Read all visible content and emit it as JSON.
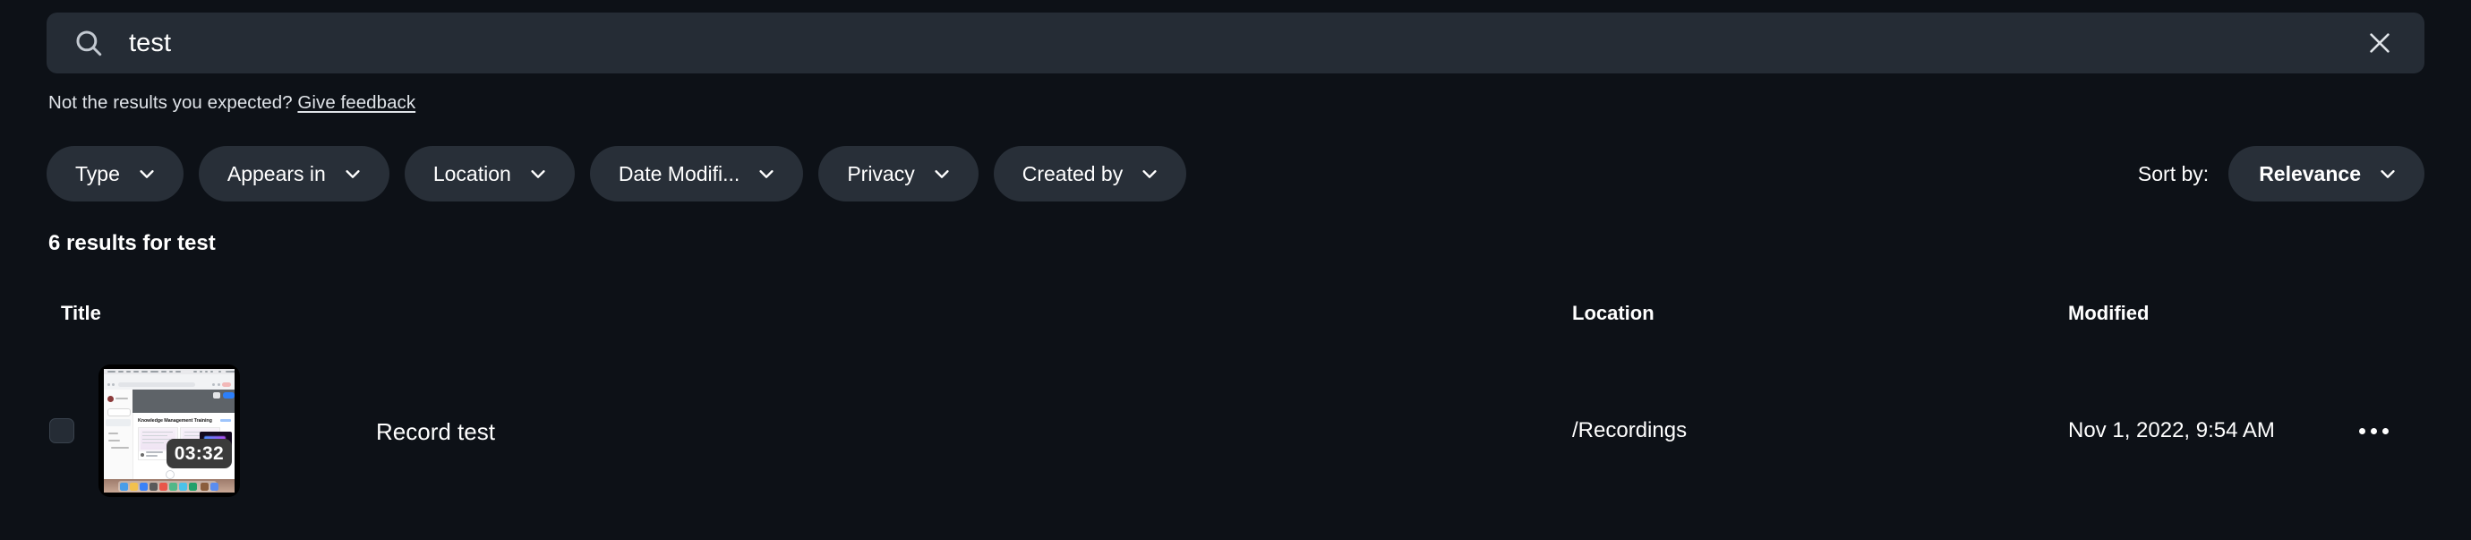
{
  "search": {
    "icon": "search-icon",
    "value": "test",
    "placeholder": "Search",
    "clear_icon": "close-icon"
  },
  "feedback": {
    "text": "Not the results you expected?",
    "link_label": "Give feedback"
  },
  "filters": [
    {
      "label": "Type",
      "icon": "chevron-down-icon"
    },
    {
      "label": "Appears in",
      "icon": "chevron-down-icon"
    },
    {
      "label": "Location",
      "icon": "chevron-down-icon"
    },
    {
      "label": "Date Modifi...",
      "icon": "chevron-down-icon"
    },
    {
      "label": "Privacy",
      "icon": "chevron-down-icon"
    },
    {
      "label": "Created by",
      "icon": "chevron-down-icon"
    }
  ],
  "sort": {
    "label": "Sort by:",
    "value": "Relevance",
    "icon": "chevron-down-icon"
  },
  "results": {
    "count_text": "6 results for test",
    "columns": {
      "title": "Title",
      "location": "Location",
      "modified": "Modified"
    },
    "rows": [
      {
        "title": "Record test",
        "location": "/Recordings",
        "modified": "Nov 1, 2022, 9:54 AM",
        "duration": "03:32",
        "thumbnail_heading": "Knowledge Management Training",
        "more_icon": "ellipsis-icon",
        "selected": false
      }
    ]
  },
  "colors": {
    "page_bg": "#0d1117",
    "field_bg": "#252c35",
    "chip_bg": "#282f38",
    "text": "#ffffff",
    "muted_text": "#dfe3e8",
    "badge_bg": "#3b3b3b",
    "accent_blue": "#2d7ff9"
  }
}
